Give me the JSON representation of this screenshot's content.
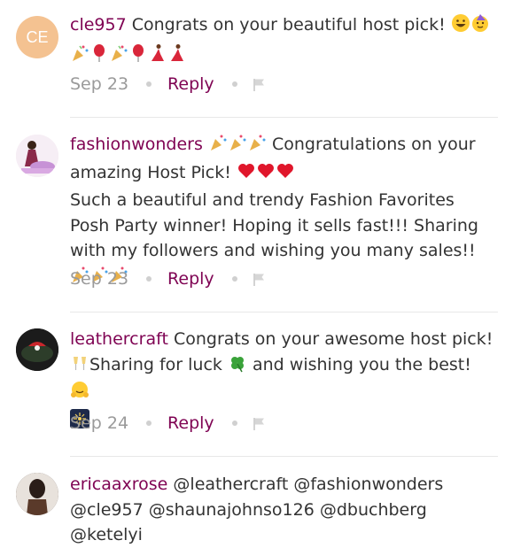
{
  "comments": [
    {
      "avatar_initials": "CE",
      "username": "cle957",
      "text": " Congrats on your beautiful host pick! ",
      "text2": "",
      "date": "Sep 23",
      "reply_label": "Reply"
    },
    {
      "username": "fashionwonders",
      "text": " Congratulations on your amazing Host Pick! ",
      "text2": "Such a beautiful and trendy Fashion Favorites Posh Party winner! Hoping it sells fast!!! Sharing with my followers and wishing you many sales!! ",
      "date": "Sep 23",
      "reply_label": "Reply"
    },
    {
      "username": "leathercraft",
      "text": " Congrats on your awesome host pick! ",
      "text2a": "Sharing for luck ",
      "text2b": " and wishing you the best! ",
      "date": "Sep 24",
      "reply_label": "Reply"
    },
    {
      "username": "ericaaxrose",
      "text": " @leathercraft @fashionwonders @cle957 @shaunajohnso126 @dbuchberg @ketelyi"
    }
  ],
  "colors": {
    "username": "#7f0353",
    "meta": "#9a9a9a",
    "divider": "#e8e8e8"
  }
}
